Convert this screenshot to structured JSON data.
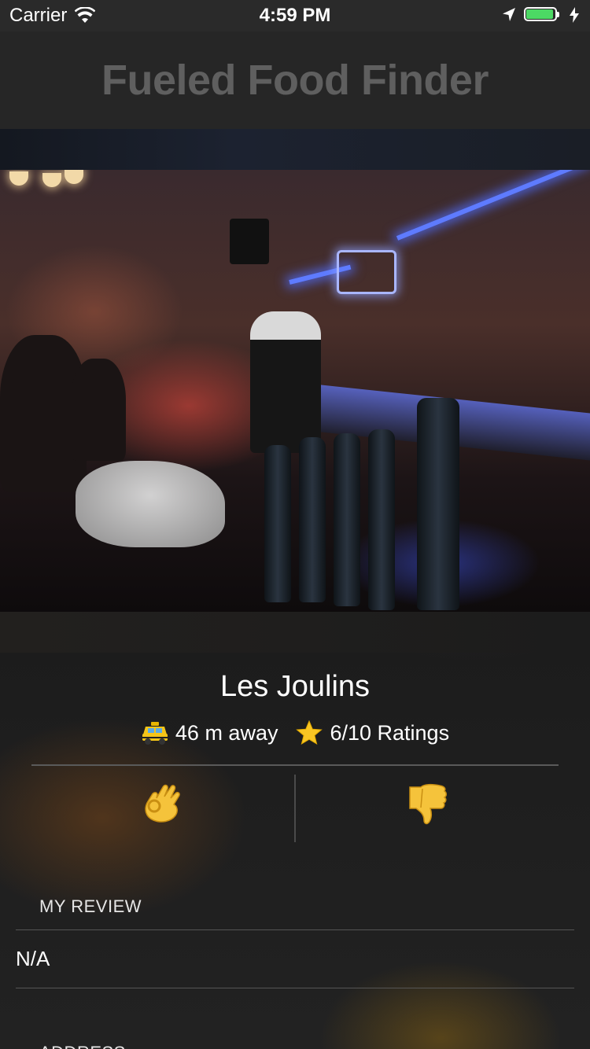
{
  "status_bar": {
    "carrier": "Carrier",
    "time": "4:59 PM"
  },
  "nav": {
    "title": "Fueled Food Finder"
  },
  "restaurant": {
    "name": "Les Joulins",
    "distance": "46 m away",
    "rating": "6/10 Ratings",
    "distance_icon": "taxi-icon",
    "rating_icon": "star-icon"
  },
  "votes": {
    "like_icon": "ok-hand-icon",
    "dislike_icon": "thumbs-down-icon"
  },
  "review_section": {
    "header": "MY REVIEW",
    "value": "N/A"
  },
  "address_section": {
    "header": "ADDRESS"
  },
  "colors": {
    "battery": "#4cd964",
    "title_gray": "#5f5f5f"
  }
}
